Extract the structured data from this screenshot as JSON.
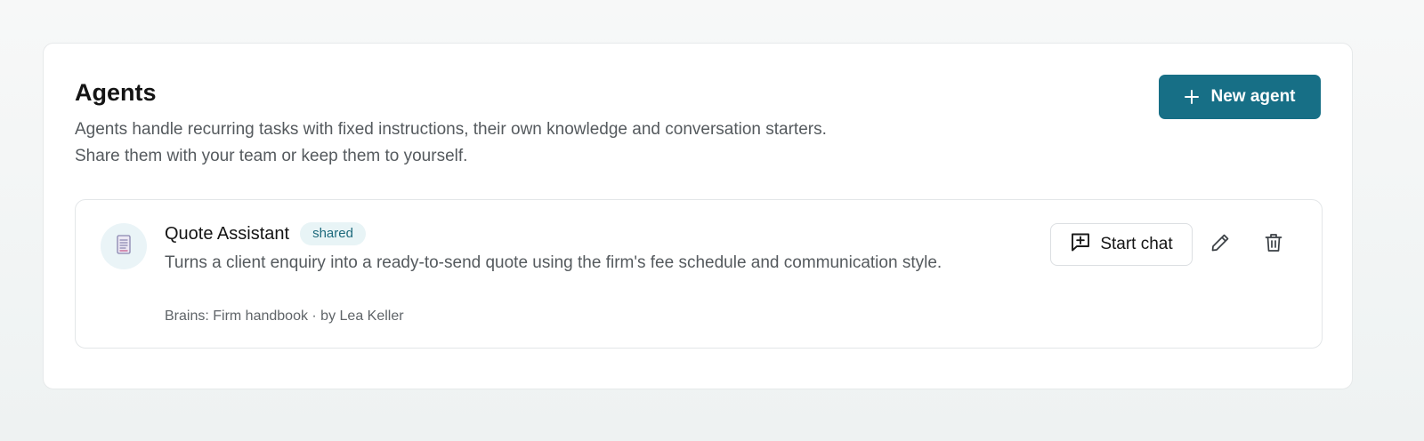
{
  "header": {
    "title": "Agents",
    "description_lines": [
      "Agents handle recurring tasks with fixed instructions, their own knowledge and conversation starters.",
      "Share them with your team or keep them to yourself."
    ],
    "new_agent_label": "New agent",
    "new_agent_icon": "plus-icon"
  },
  "agents": [
    {
      "name": "Quote Assistant",
      "badge": "shared",
      "description": "Turns a client enquiry into a ready-to-send quote using the firm's fee schedule and communication style.",
      "meta": "Brains: Firm handbook · by Lea Keller",
      "avatar_icon": "document-icon",
      "actions": {
        "start_chat_label": "Start chat",
        "start_chat_icon": "message-plus-icon",
        "edit_icon": "pencil-icon",
        "delete_icon": "trash-icon"
      }
    }
  ],
  "colors": {
    "primary": "#176f86",
    "badge_bg": "#e8f4f6",
    "badge_text": "#1d6a7c",
    "avatar_bg": "#eaf4f7"
  }
}
